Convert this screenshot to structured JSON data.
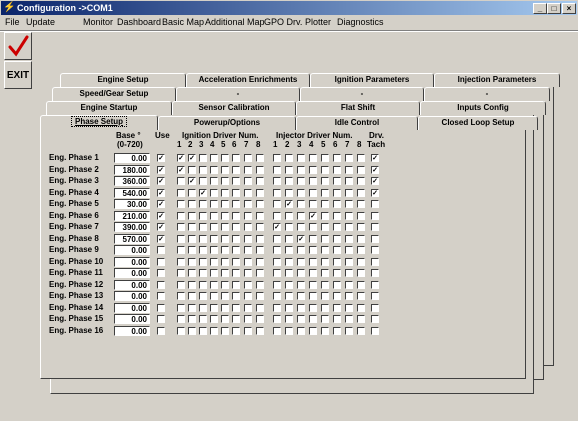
{
  "window": {
    "title": "Configuration ->COM1",
    "controls": {
      "minimize": "_",
      "maximize": "□",
      "close": "×"
    }
  },
  "menu": [
    "File",
    "Update",
    "Monitor",
    "Dashboard",
    "Basic Map",
    "Additional Map",
    "GPO Drv.",
    "Plotter",
    "Diagnostics"
  ],
  "toolbar": {
    "ok_icon": "check-icon",
    "exit_label": "EXIT"
  },
  "tabs": {
    "row1": [
      "Engine Setup",
      "Acceleration Enrichments",
      "Ignition Parameters",
      "Injection Parameters"
    ],
    "row2": [
      "Speed/Gear Setup",
      "-",
      "-",
      "-"
    ],
    "row3": [
      "Engine Startup",
      "Sensor Calibration",
      "Flat Shift",
      "Inputs Config"
    ],
    "row4": [
      "Phase Setup",
      "Powerup/Options",
      "Idle Control",
      "Closed Loop Setup"
    ]
  },
  "headers": {
    "base": "Base °",
    "base_range": "(0-720)",
    "use": "Use",
    "ignition": "Ignition Driver Num.",
    "injector": "Injector Driver Num.",
    "drv": "Drv.",
    "tach": "Tach",
    "driver_nums": [
      "1",
      "2",
      "3",
      "4",
      "5",
      "6",
      "7",
      "8"
    ]
  },
  "phases": [
    {
      "label": "Eng. Phase 1",
      "base": "0.00",
      "use": true,
      "ign": [
        1,
        2
      ],
      "inj": [],
      "tach": true
    },
    {
      "label": "Eng. Phase 2",
      "base": "180.00",
      "use": true,
      "ign": [
        1
      ],
      "inj": [],
      "tach": true
    },
    {
      "label": "Eng. Phase 3",
      "base": "360.00",
      "use": true,
      "ign": [
        2
      ],
      "inj": [],
      "tach": true
    },
    {
      "label": "Eng. Phase 4",
      "base": "540.00",
      "use": true,
      "ign": [
        3
      ],
      "inj": [],
      "tach": true
    },
    {
      "label": "Eng. Phase 5",
      "base": "30.00",
      "use": true,
      "ign": [],
      "inj": [
        2
      ],
      "tach": false
    },
    {
      "label": "Eng. Phase 6",
      "base": "210.00",
      "use": true,
      "ign": [],
      "inj": [
        4
      ],
      "tach": false
    },
    {
      "label": "Eng. Phase 7",
      "base": "390.00",
      "use": true,
      "ign": [],
      "inj": [
        1
      ],
      "tach": false
    },
    {
      "label": "Eng. Phase 8",
      "base": "570.00",
      "use": true,
      "ign": [],
      "inj": [
        3
      ],
      "tach": false
    },
    {
      "label": "Eng. Phase 9",
      "base": "0.00",
      "use": false,
      "ign": [],
      "inj": [],
      "tach": false
    },
    {
      "label": "Eng. Phase 10",
      "base": "0.00",
      "use": false,
      "ign": [],
      "inj": [],
      "tach": false
    },
    {
      "label": "Eng. Phase 11",
      "base": "0.00",
      "use": false,
      "ign": [],
      "inj": [],
      "tach": false
    },
    {
      "label": "Eng. Phase 12",
      "base": "0.00",
      "use": false,
      "ign": [],
      "inj": [],
      "tach": false
    },
    {
      "label": "Eng. Phase 13",
      "base": "0.00",
      "use": false,
      "ign": [],
      "inj": [],
      "tach": false
    },
    {
      "label": "Eng. Phase 14",
      "base": "0.00",
      "use": false,
      "ign": [],
      "inj": [],
      "tach": false
    },
    {
      "label": "Eng. Phase 15",
      "base": "0.00",
      "use": false,
      "ign": [],
      "inj": [],
      "tach": false
    },
    {
      "label": "Eng. Phase 16",
      "base": "0.00",
      "use": false,
      "ign": [],
      "inj": [],
      "tach": false
    }
  ],
  "colors": {
    "titlebar_start": "#0a246a",
    "titlebar_end": "#a6caf0",
    "face": "#d4d0c8",
    "check": "#cc0000"
  }
}
